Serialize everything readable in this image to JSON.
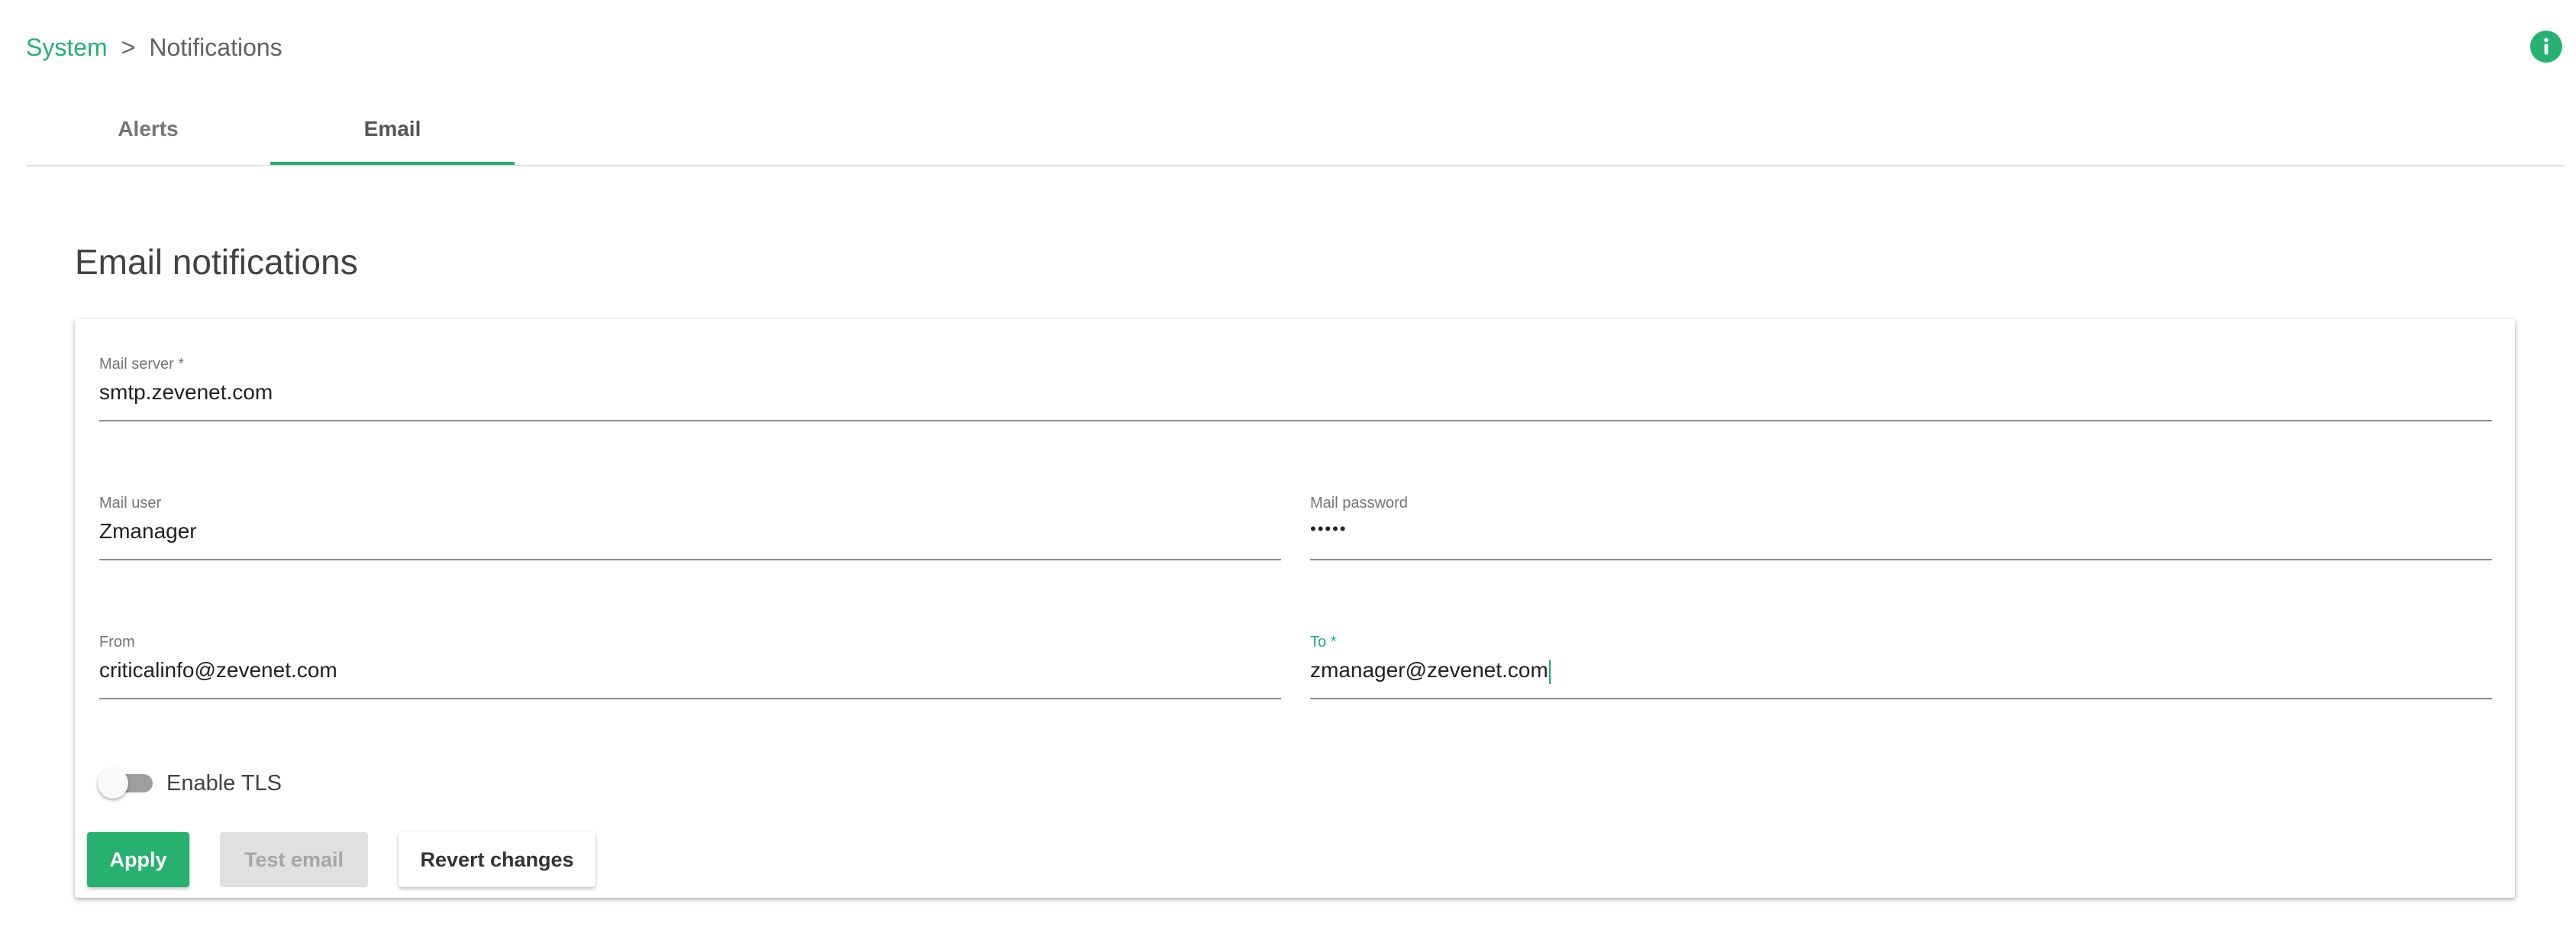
{
  "breadcrumb": {
    "root": "System",
    "separator": ">",
    "current": "Notifications"
  },
  "header": {
    "info_icon": "info-icon"
  },
  "tabs": [
    {
      "label": "Alerts",
      "active": false
    },
    {
      "label": "Email",
      "active": true
    }
  ],
  "section": {
    "title": "Email notifications"
  },
  "form": {
    "mail_server": {
      "label": "Mail server *",
      "value": "smtp.zevenet.com"
    },
    "mail_user": {
      "label": "Mail user",
      "value": "Zmanager"
    },
    "mail_password": {
      "label": "Mail password",
      "value": "•••••"
    },
    "from": {
      "label": "From",
      "value": "criticalinfo@zevenet.com"
    },
    "to": {
      "label": "To *",
      "value": "zmanager@zevenet.com",
      "focused": true
    },
    "tls": {
      "label": "Enable TLS",
      "enabled": false
    }
  },
  "buttons": {
    "apply": "Apply",
    "test": "Test email",
    "revert": "Revert changes"
  },
  "colors": {
    "accent": "#26b170",
    "disabled_bg": "#e0e0e0",
    "toggle_off_track": "#9e9e9e"
  }
}
